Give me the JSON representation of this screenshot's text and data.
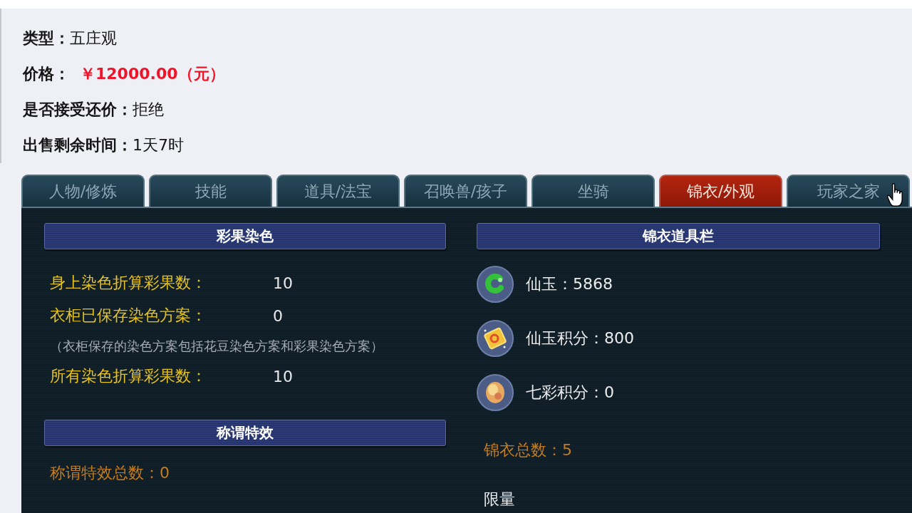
{
  "listing": {
    "fields": [
      {
        "kind": "plain",
        "label": "类型：",
        "value": "五庄观"
      },
      {
        "kind": "price",
        "label": "价格：",
        "value": "￥12000.00（元）"
      },
      {
        "kind": "plain",
        "label": "是否接受还价：",
        "value": "拒绝"
      },
      {
        "kind": "plain",
        "label": "出售剩余时间：",
        "value": "1天7时"
      }
    ]
  },
  "tabs": [
    {
      "label": "人物/修炼",
      "selected": false
    },
    {
      "label": "技能",
      "selected": false
    },
    {
      "label": "道具/法宝",
      "selected": false
    },
    {
      "label": "召唤兽/孩子",
      "selected": false
    },
    {
      "label": "坐骑",
      "selected": false
    },
    {
      "label": "锦衣/外观",
      "selected": true
    },
    {
      "label": "玩家之家",
      "selected": false
    }
  ],
  "left_panel": {
    "sections": [
      {
        "title": "彩果染色",
        "rows": [
          {
            "kind": "stat",
            "label": "身上染色折算彩果数：",
            "value": "10"
          },
          {
            "kind": "stat",
            "label": "衣柜已保存染色方案：",
            "value": "0"
          },
          {
            "kind": "note",
            "text": "（衣柜保存的染色方案包括花豆染色方案和彩果染色方案）"
          },
          {
            "kind": "stat",
            "label": "所有染色折算彩果数：",
            "value": "10"
          }
        ]
      },
      {
        "title": "称谓特效",
        "rows": [
          {
            "kind": "total",
            "text": "称谓特效总数：0"
          }
        ]
      }
    ]
  },
  "right_panel": {
    "title": "锦衣道具栏",
    "items": [
      {
        "kind": "jade",
        "text": "仙玉：5868"
      },
      {
        "kind": "card",
        "text": "仙玉积分：800"
      },
      {
        "kind": "orb",
        "text": "七彩积分：0"
      }
    ],
    "total": "锦衣总数：5",
    "footer": "限量"
  }
}
